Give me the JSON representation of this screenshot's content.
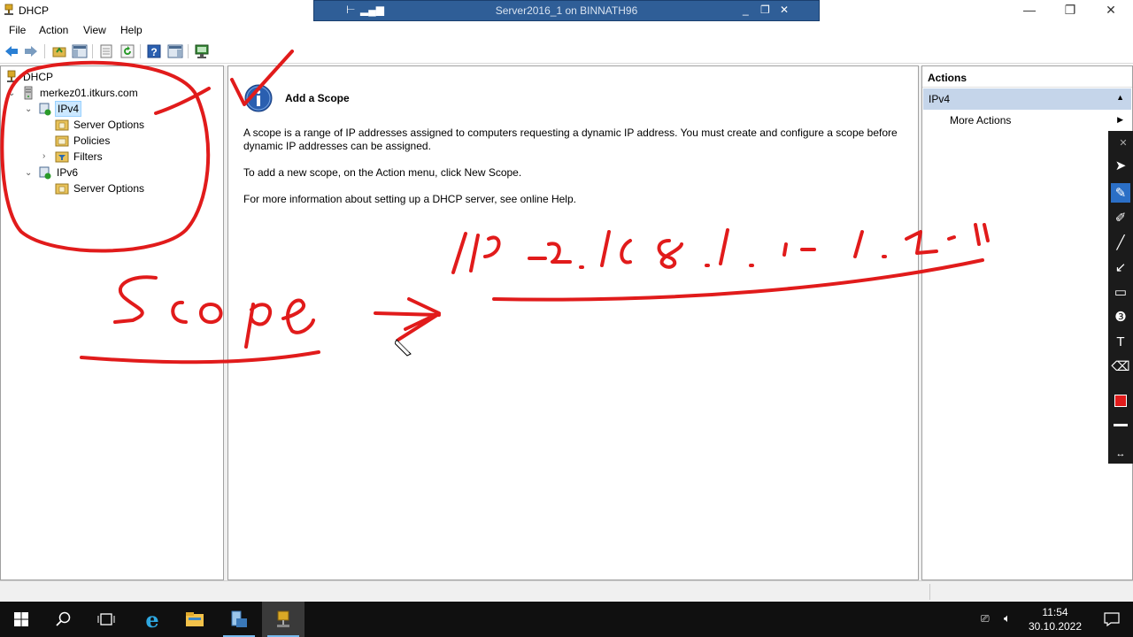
{
  "window": {
    "title": "DHCP",
    "minimize": "—",
    "maximize": "❐",
    "close": "✕"
  },
  "rdp": {
    "title": "Server2016_1 on BINNATH96"
  },
  "menu": {
    "file": "File",
    "action": "Action",
    "view": "View",
    "help": "Help"
  },
  "toolbar": {
    "icons": [
      "back-icon",
      "forward-icon",
      "up-folder-icon",
      "show-hide-console-tree-icon",
      "export-list-icon",
      "refresh-icon",
      "help-icon",
      "show-hide-action-pane-icon",
      "monitor-icon"
    ]
  },
  "tree": {
    "root": "DHCP",
    "server": "merkez01.itkurs.com",
    "ipv4": "IPv4",
    "ipv4_server_options": "Server Options",
    "policies": "Policies",
    "filters": "Filters",
    "ipv6": "IPv6",
    "ipv6_server_options": "Server Options"
  },
  "content": {
    "heading": "Add a Scope",
    "paragraph1": "A scope is a range of IP addresses assigned to computers requesting a dynamic IP address. You must create and configure a scope before dynamic IP addresses can be assigned.",
    "paragraph2": "To add a new scope, on the Action menu, click New Scope.",
    "paragraph3": "For more information about setting up a DHCP server, see online Help."
  },
  "actions": {
    "header": "Actions",
    "section": "IPv4",
    "more_actions": "More Actions"
  },
  "taskbar": {
    "time": "11:54",
    "date": "30.10.2022"
  },
  "colors": {
    "annotation": "#e11b1b",
    "selection": "#cce8ff",
    "actions_section": "#c5d5ea",
    "rdp_bar": "#2f5e97",
    "taskbar": "#101010"
  }
}
